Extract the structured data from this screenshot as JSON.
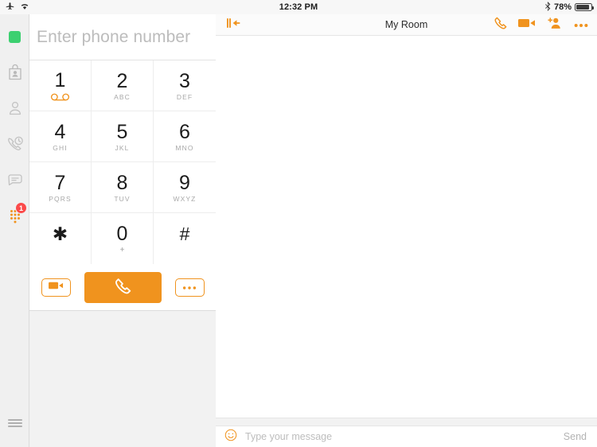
{
  "statusbar": {
    "airplane_icon": "airplane-icon",
    "wifi_icon": "wifi-icon",
    "time": "12:32 PM",
    "bluetooth_icon": "bluetooth-icon",
    "battery_percent": "78%",
    "battery_icon": "battery-icon"
  },
  "sidebar": {
    "items": [
      {
        "name": "presence-status",
        "icon": "green-square-status-icon",
        "label": ""
      },
      {
        "name": "contact-card",
        "icon": "contact-card-icon",
        "label": ""
      },
      {
        "name": "profile",
        "icon": "person-icon",
        "label": ""
      },
      {
        "name": "call-history",
        "icon": "call-history-icon",
        "label": ""
      },
      {
        "name": "messages",
        "icon": "chat-bubble-icon",
        "label": ""
      },
      {
        "name": "dialpad",
        "icon": "dialpad-icon",
        "label": "",
        "badge": "1"
      }
    ],
    "menu_icon": "hamburger-menu-icon",
    "badge_color": "#fb4a4a",
    "active_color": "#f0931e",
    "status_color": "#3cd070"
  },
  "dialer": {
    "input_placeholder": "Enter phone number",
    "input_value": "",
    "keys": [
      {
        "digit": "1",
        "sub": "",
        "icon": "voicemail-icon"
      },
      {
        "digit": "2",
        "sub": "ABC",
        "icon": ""
      },
      {
        "digit": "3",
        "sub": "DEF",
        "icon": ""
      },
      {
        "digit": "4",
        "sub": "GHI",
        "icon": ""
      },
      {
        "digit": "5",
        "sub": "JKL",
        "icon": ""
      },
      {
        "digit": "6",
        "sub": "MNO",
        "icon": ""
      },
      {
        "digit": "7",
        "sub": "PQRS",
        "icon": ""
      },
      {
        "digit": "8",
        "sub": "TUV",
        "icon": ""
      },
      {
        "digit": "9",
        "sub": "WXYZ",
        "icon": ""
      },
      {
        "digit": "✱",
        "sub": "",
        "icon": ""
      },
      {
        "digit": "0",
        "sub": "+",
        "icon": ""
      },
      {
        "digit": "#",
        "sub": "",
        "icon": ""
      }
    ],
    "actions": {
      "video_icon": "video-camera-icon",
      "call_icon": "phone-handset-icon",
      "more_icon": "more-dots-icon"
    },
    "accent_color": "#f0931e"
  },
  "chat": {
    "collapse_icon": "collapse-panel-icon",
    "title": "My Room",
    "tools": [
      {
        "name": "audio-call",
        "icon": "phone-handset-icon"
      },
      {
        "name": "video-call",
        "icon": "video-camera-icon"
      },
      {
        "name": "add-participant",
        "icon": "add-person-icon"
      },
      {
        "name": "more-options",
        "icon": "more-dots-icon"
      }
    ],
    "composer": {
      "emoji_icon": "emoji-smiley-icon",
      "placeholder": "Type your message",
      "value": "",
      "send_label": "Send"
    },
    "accent_color": "#f0931e"
  }
}
